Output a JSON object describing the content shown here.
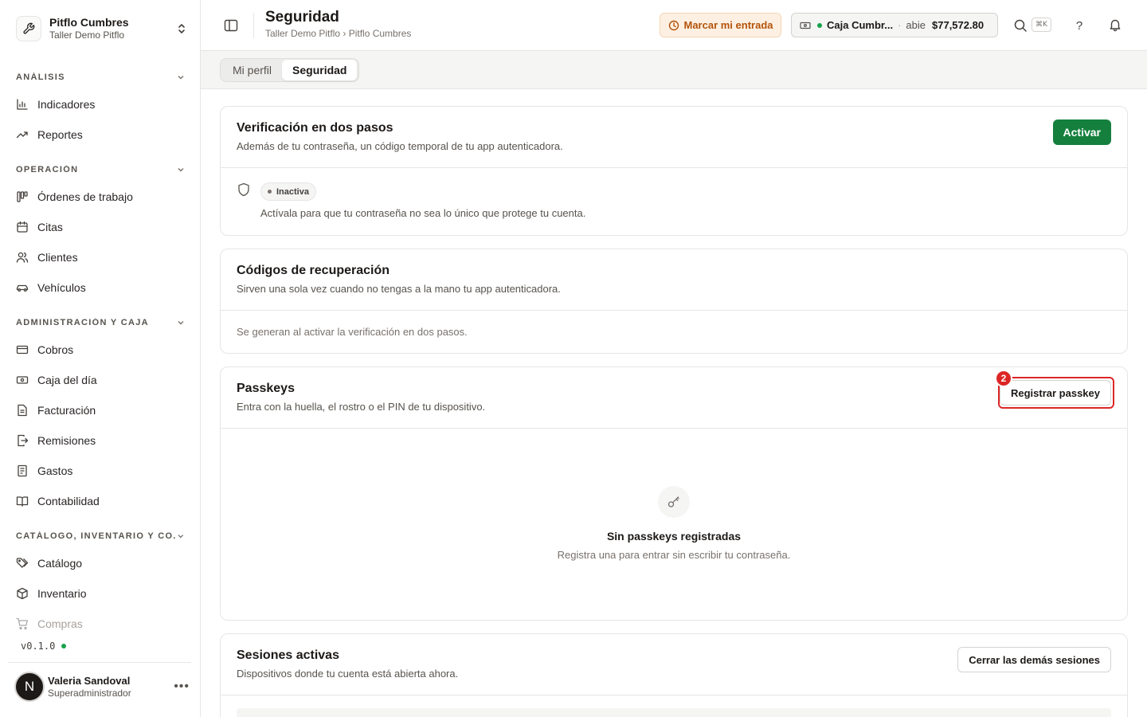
{
  "sidebar": {
    "org_name": "Pitflo Cumbres",
    "org_sub": "Taller Demo Pitflo",
    "sections": [
      {
        "title": "ANÁLISIS",
        "items": [
          "Indicadores",
          "Reportes"
        ]
      },
      {
        "title": "OPERACIÓN",
        "items": [
          "Órdenes de trabajo",
          "Citas",
          "Clientes",
          "Vehículos"
        ]
      },
      {
        "title": "ADMINISTRACIÓN Y CAJA",
        "items": [
          "Cobros",
          "Caja del día",
          "Facturación",
          "Remisiones",
          "Gastos",
          "Contabilidad"
        ]
      },
      {
        "title": "CATÁLOGO, INVENTARIO Y CO...",
        "items": [
          "Catálogo",
          "Inventario",
          "Compras"
        ]
      }
    ],
    "version": "v0.1.0",
    "user": {
      "initial": "N",
      "name": "Valeria Sandoval",
      "role": "Superadministrador"
    }
  },
  "header": {
    "title": "Seguridad",
    "breadcrumb": "Taller Demo Pitflo › Pitflo Cumbres",
    "clock_in": "Marcar mi entrada",
    "cash": {
      "name": "Caja Cumbr...",
      "separator": "·",
      "state": "abie",
      "amount": "$77,572.80"
    },
    "shortcut": "⌘K",
    "help": "?"
  },
  "tabs": [
    {
      "label": "Mi perfil",
      "active": false
    },
    {
      "label": "Seguridad",
      "active": true
    }
  ],
  "two_factor": {
    "title": "Verificación en dos pasos",
    "subtitle": "Además de tu contraseña, un código temporal de tu app autenticadora.",
    "button": "Activar",
    "status": "Inactiva",
    "note": "Actívala para que tu contraseña no sea lo único que protege tu cuenta."
  },
  "recovery": {
    "title": "Códigos de recuperación",
    "subtitle": "Sirven una sola vez cuando no tengas a la mano tu app autenticadora.",
    "note": "Se generan al activar la verificación en dos pasos."
  },
  "passkeys": {
    "title": "Passkeys",
    "subtitle": "Entra con la huella, el rostro o el PIN de tu dispositivo.",
    "button": "Registrar passkey",
    "marker": "2",
    "empty_title": "Sin passkeys registradas",
    "empty_subtitle": "Registra una para entrar sin escribir tu contraseña."
  },
  "sessions": {
    "title": "Sesiones activas",
    "subtitle": "Dispositivos donde tu cuenta está abierta ahora.",
    "button": "Cerrar las demás sesiones"
  },
  "colors": {
    "primary": "#15803d",
    "accent_warning": "#b45309",
    "highlight": "#dc2626",
    "online": "#16a34a"
  }
}
